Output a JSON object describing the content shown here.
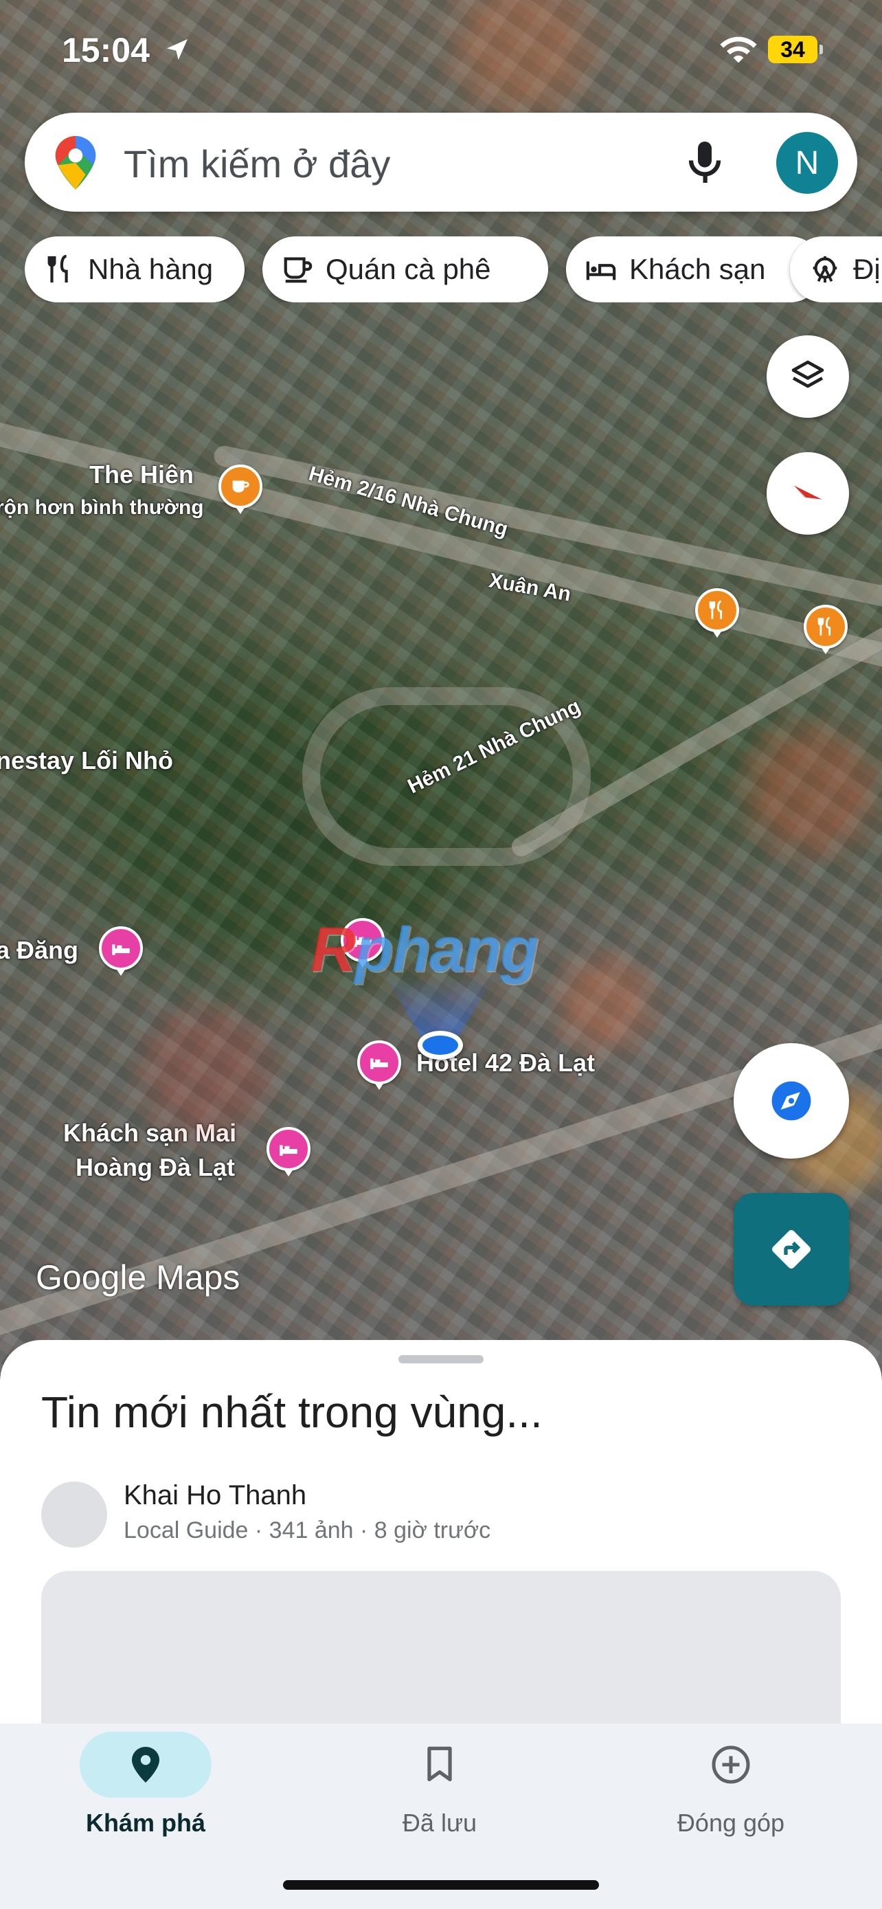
{
  "status_bar": {
    "time": "15:04",
    "battery": "34"
  },
  "search": {
    "placeholder": "Tìm kiếm ở đây",
    "avatar_letter": "N"
  },
  "chips": [
    {
      "label": "Nhà hàng",
      "icon": "restaurant-icon"
    },
    {
      "label": "Quán cà phê",
      "icon": "coffee-icon"
    },
    {
      "label": "Khách sạn",
      "icon": "hotel-icon"
    },
    {
      "label": "Đị",
      "icon": "attraction-icon"
    }
  ],
  "map": {
    "streets": [
      "Hẻm 2/16 Nhà Chung",
      "Xuân An",
      "Hẻm 21 Nhà Chung"
    ],
    "places": {
      "the_hien": "The Hiên",
      "the_hien_sub": "rộn hơn bình thường",
      "homestay": "nestay Lối Nhỏ",
      "dang": "a Đăng",
      "hotel42": "Hotel 42 Đà Lạt",
      "mai_hoang_line1": "Khách sạn Mai",
      "mai_hoang_line2": "Hoàng Đà Lạt"
    },
    "watermark_r": "R",
    "watermark_rest": "phang",
    "logo": "Google Maps"
  },
  "sheet": {
    "title": "Tin mới nhất trong vùng...",
    "post": {
      "author": "Khai Ho Thanh",
      "meta": "Local Guide · 341 ảnh · 8 giờ trước"
    }
  },
  "nav": [
    {
      "label": "Khám phá",
      "icon": "explore-pin-icon",
      "active": true
    },
    {
      "label": "Đã lưu",
      "icon": "bookmark-icon",
      "active": false
    },
    {
      "label": "Đóng góp",
      "icon": "add-circle-icon",
      "active": false
    }
  ],
  "colors": {
    "accent_teal": "#0f6f7d",
    "nav_active_pill": "#c7ecf3",
    "poi_food": "#f08a1c",
    "poi_hotel": "#e83fa4",
    "location_blue": "#1a73e8"
  }
}
